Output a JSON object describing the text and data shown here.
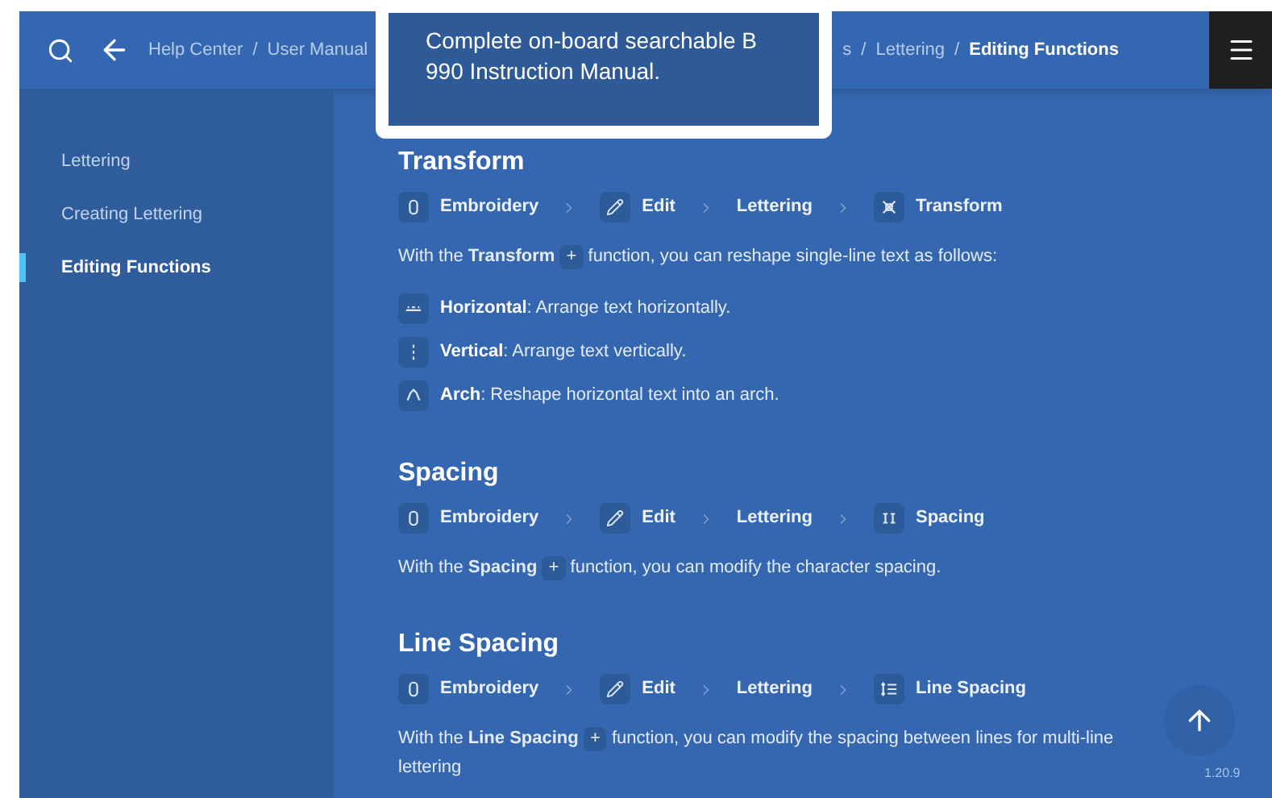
{
  "header": {
    "separator": "/",
    "breadcrumb_left": [
      "Help Center",
      "User Manual"
    ],
    "breadcrumb_right": [
      "s",
      "Lettering",
      "Editing Functions"
    ]
  },
  "tooltip": {
    "text": "Complete on-board searchable B 990 Instruction Manual."
  },
  "sidebar": {
    "items": [
      {
        "label": "Lettering",
        "selected": false
      },
      {
        "label": "Creating Lettering",
        "selected": false
      },
      {
        "label": "Editing Functions",
        "selected": true
      }
    ]
  },
  "sections": [
    {
      "title": "Transform",
      "path": [
        {
          "kind": "embroidery",
          "label": "Embroidery"
        },
        {
          "kind": "edit",
          "label": "Edit"
        },
        {
          "kind": "plain",
          "label": "Lettering"
        },
        {
          "kind": "transform",
          "label": "Transform"
        }
      ],
      "text_before": "With the **Transform**",
      "plus": "+",
      "text_after": "function, you can reshape single-line text as follows:",
      "options": [
        {
          "kind": "horizontal",
          "term": "Horizontal",
          "text": ": Arrange text horizontally."
        },
        {
          "kind": "vertical",
          "term": "Vertical",
          "text": ": Arrange text vertically."
        },
        {
          "kind": "arch",
          "term": "Arch",
          "text": ": Reshape horizontal text into an arch."
        }
      ]
    },
    {
      "title": "Spacing",
      "path": [
        {
          "kind": "embroidery",
          "label": "Embroidery"
        },
        {
          "kind": "edit",
          "label": "Edit"
        },
        {
          "kind": "plain",
          "label": "Lettering"
        },
        {
          "kind": "spacing",
          "label": "Spacing"
        }
      ],
      "text_before": "With the **Spacing**",
      "plus": "+",
      "text_after": "function, you can modify the character spacing."
    },
    {
      "title": "Line Spacing",
      "path": [
        {
          "kind": "embroidery",
          "label": "Embroidery"
        },
        {
          "kind": "edit",
          "label": "Edit"
        },
        {
          "kind": "plain",
          "label": "Lettering"
        },
        {
          "kind": "line-spacing",
          "label": "Line Spacing"
        }
      ],
      "text_before": "With the **Line Spacing**",
      "plus": "+",
      "text_after": "function, you can modify the spacing between lines for multi-line lettering"
    }
  ],
  "version": "1.20.9"
}
